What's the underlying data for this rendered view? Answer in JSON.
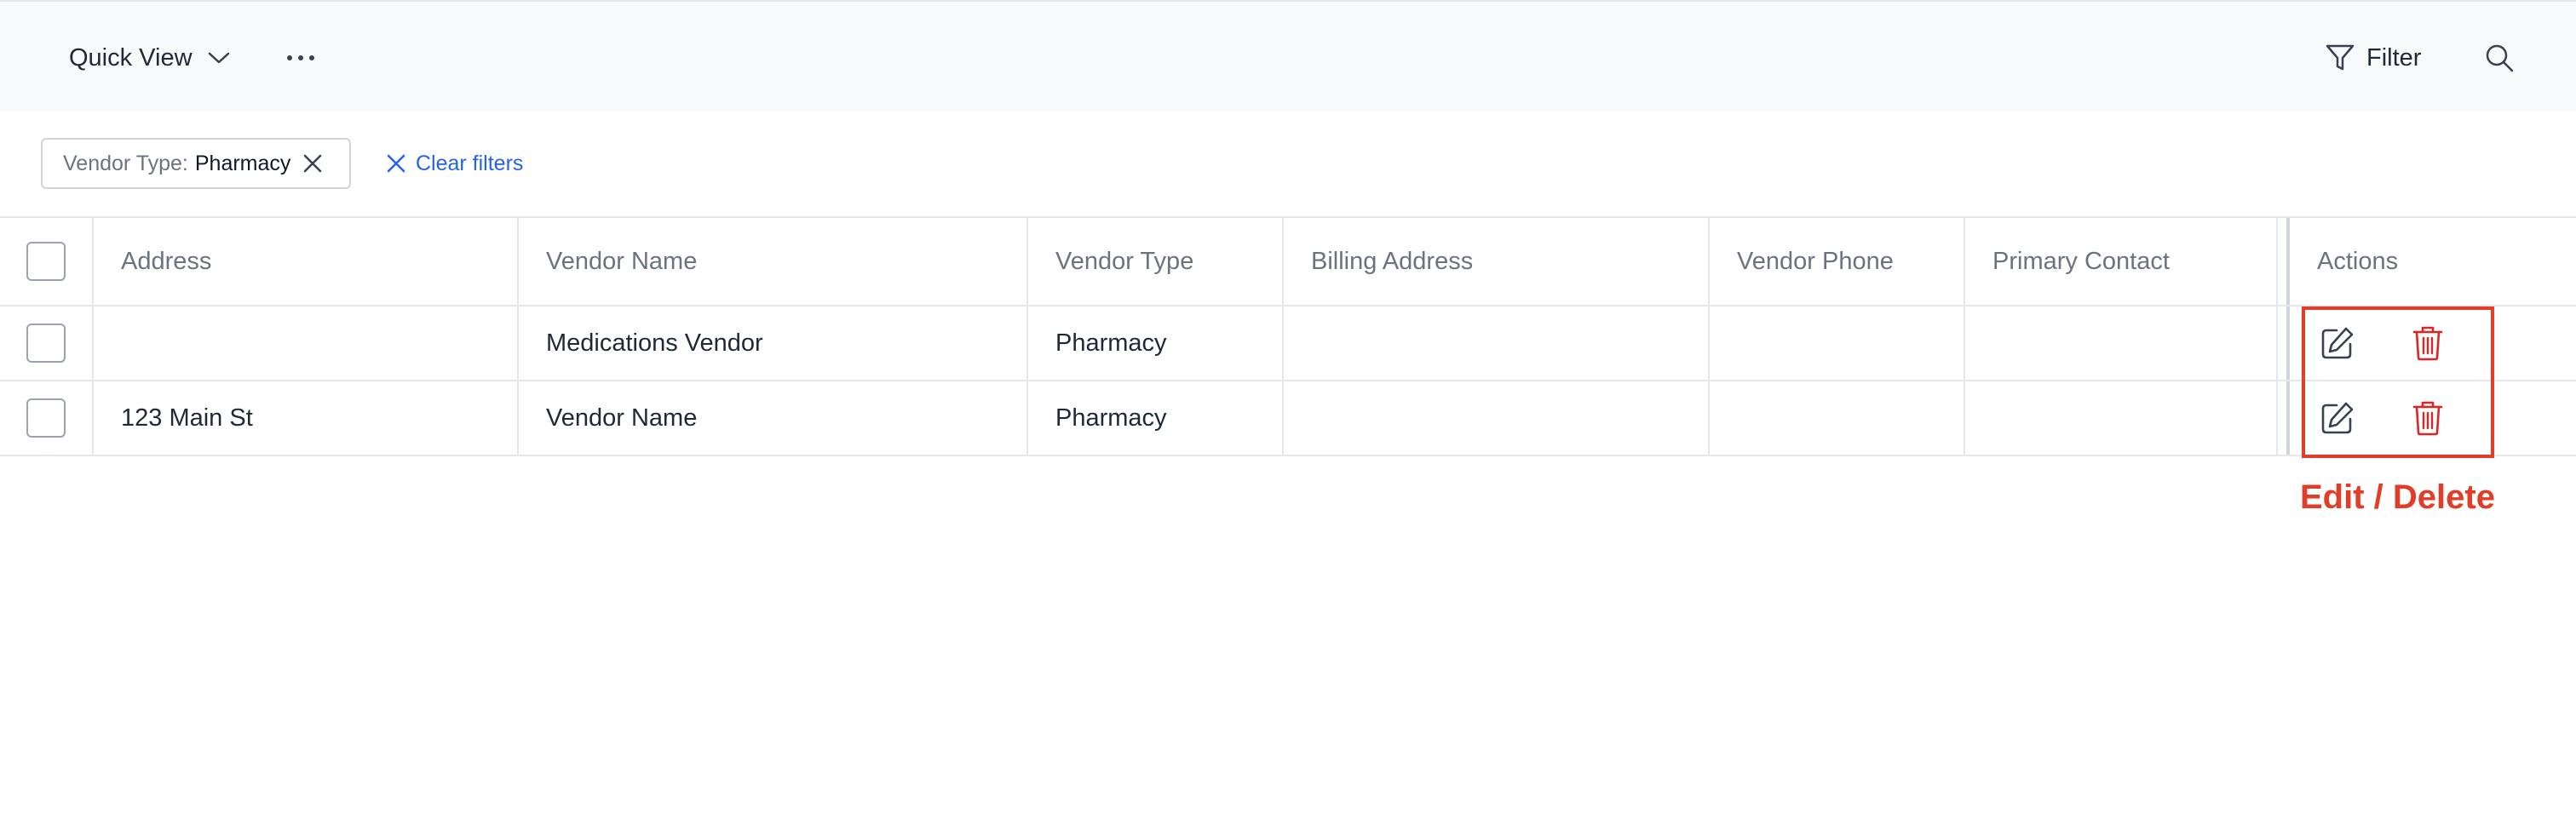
{
  "toolbar": {
    "view_label": "Quick View",
    "filter_label": "Filter"
  },
  "filters": {
    "chip_key": "Vendor Type:",
    "chip_value": "Pharmacy",
    "clear_label": "Clear filters"
  },
  "table": {
    "columns": [
      "Address",
      "Vendor Name",
      "Vendor Type",
      "Billing Address",
      "Vendor Phone",
      "Primary Contact",
      "Actions"
    ],
    "rows": [
      {
        "address": "",
        "vendor_name": "Medications Vendor",
        "vendor_type": "Pharmacy",
        "billing_address": "",
        "vendor_phone": "",
        "primary_contact": ""
      },
      {
        "address": "123 Main St",
        "vendor_name": "Vendor Name",
        "vendor_type": "Pharmacy",
        "billing_address": "",
        "vendor_phone": "",
        "primary_contact": ""
      }
    ]
  },
  "annotation": {
    "text": "Edit / Delete",
    "color": "#e23d28"
  },
  "icons": {
    "dropdown": "chevron-down-icon",
    "more": "more-horizontal-icon",
    "filter": "filter-icon",
    "search": "search-icon",
    "remove": "close-icon",
    "edit": "edit-icon",
    "delete": "trash-icon"
  },
  "colors": {
    "toolbar_bg": "#f8f9fb",
    "link": "#2563eb",
    "delete": "#dc2626",
    "annotation": "#e23d28"
  }
}
